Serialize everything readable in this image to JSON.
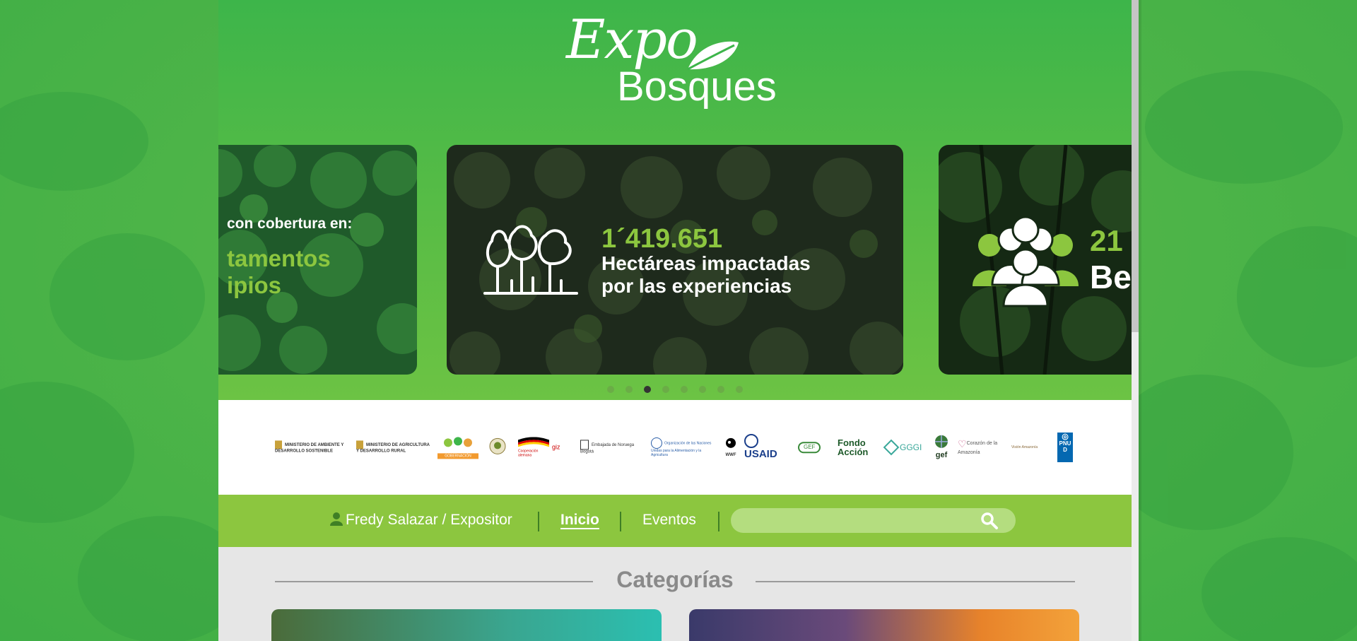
{
  "brand": {
    "logo_line1": "Expo",
    "logo_line2": "Bosques",
    "primary_color": "#3db54a",
    "accent_color": "#8cc63f"
  },
  "carousel": {
    "slides": [
      {
        "line1": "con cobertura en:",
        "line2": "tamentos",
        "line3": "ipios",
        "icon": "map-icon"
      },
      {
        "value": "1´419.651",
        "line1": "Hectáreas impactadas",
        "line2": "por las experiencias",
        "icon": "forest-icon"
      },
      {
        "value": "21",
        "line1": "Be",
        "icon": "people-group-icon"
      }
    ],
    "dot_count": 8,
    "active_dot": 3
  },
  "sponsors": [
    "MINISTERIO DE AMBIENTE Y DESARROLLO SOSTENIBLE",
    "MINISTERIO DE AGRICULTURA Y DESARROLLO RURAL",
    "GOBERNACIÓN",
    "PIMSAB",
    "Cooperación alemana",
    "giz",
    "Embajada de Noruega Bogotá",
    "Organización de las Naciones Unidas para la Alimentación y la Agricultura",
    "WWF",
    "USAID",
    "GEF",
    "Fondo Acción",
    "GGGI",
    "gef",
    "Corazón de la Amazonía",
    "Visión Amazonía",
    "PNUD"
  ],
  "nav": {
    "user_label": "Fredy Salazar / Expositor",
    "home_label": "Inicio",
    "events_label": "Eventos",
    "search_placeholder": "",
    "search_value": ""
  },
  "content": {
    "section_title": "Categorías"
  }
}
